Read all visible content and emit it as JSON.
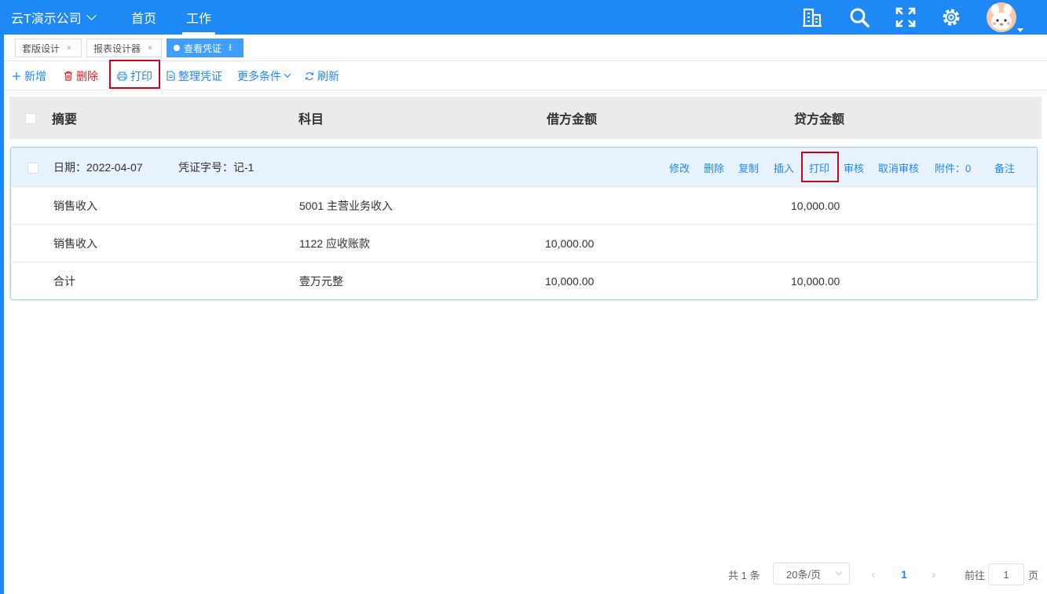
{
  "header": {
    "company": "云T演示公司",
    "nav": [
      {
        "label": "首页"
      },
      {
        "label": "工作"
      }
    ],
    "active_nav": "工作",
    "icons": [
      "building-icon",
      "search-icon",
      "fullscreen-icon",
      "gear-icon",
      "avatar"
    ],
    "brand_color": "#1e88f5"
  },
  "tabs": [
    {
      "label": "套版设计",
      "close": "×"
    },
    {
      "label": "报表设计器",
      "close": "×"
    },
    {
      "label": "查看凭证",
      "pin": "⭳",
      "active": true
    }
  ],
  "toolbar": {
    "add": "新增",
    "delete": "删除",
    "print": "打印",
    "organize": "整理凭证",
    "more": "更多条件",
    "refresh": "刷新"
  },
  "table": {
    "columns": [
      "摘要",
      "科目",
      "借方金额",
      "贷方金额"
    ]
  },
  "voucher": {
    "date_label": "日期：",
    "date": "2022-04-07",
    "number_label": "凭证字号：",
    "number": "记-1",
    "actions": {
      "edit": "修改",
      "delete": "删除",
      "copy": "复制",
      "insert": "插入",
      "print": "打印",
      "audit": "审核",
      "unaudit": "取消审核",
      "attachment": "附件：0",
      "remark": "备注"
    },
    "rows": [
      {
        "summary": "销售收入",
        "account": "5001 主营业务收入",
        "debit": "",
        "credit": "10,000.00"
      },
      {
        "summary": "销售收入",
        "account": "1122 应收账款",
        "debit": "10,000.00",
        "credit": ""
      },
      {
        "summary": "合计",
        "account": "壹万元整",
        "debit": "10,000.00",
        "credit": "10,000.00"
      }
    ]
  },
  "pagination": {
    "total": "共 1 条",
    "page_size": "20条/页",
    "prev": "‹",
    "current": "1",
    "next": "›",
    "goto_label": "前往",
    "goto_value": "1",
    "page_unit": "页"
  },
  "highlight_color": "#d0021b"
}
